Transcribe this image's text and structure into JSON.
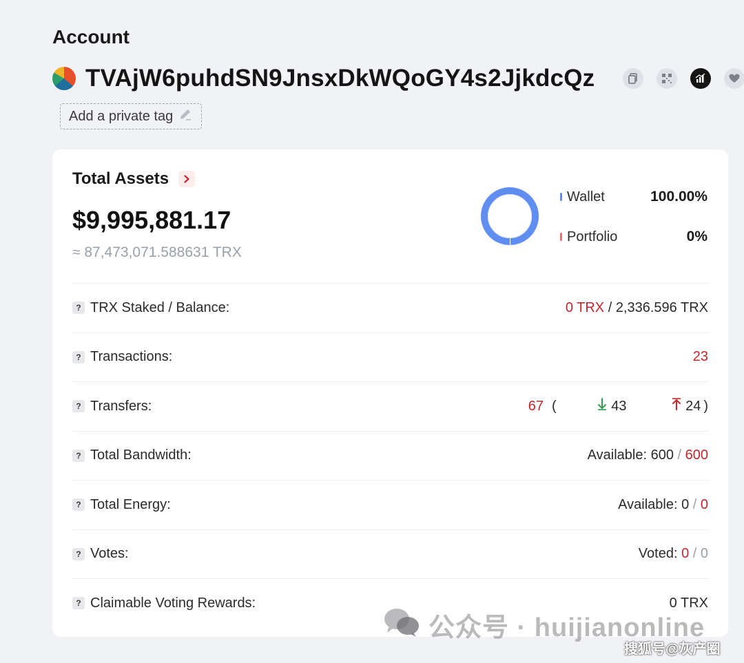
{
  "header": {
    "title": "Account",
    "address": "TVAjW6puhdSN9JnsxDkWQoGY4s2JjkdcQz",
    "tag_button_label": "Add a private tag",
    "icons": [
      "copy-icon",
      "qr-code-icon",
      "analytics-icon",
      "heart-icon",
      "more-icon"
    ]
  },
  "assets": {
    "title": "Total Assets",
    "usd": "$9,995,881.17",
    "trx": "≈ 87,473,071.588631 TRX",
    "legend": [
      {
        "name": "Wallet",
        "value": "100.00%",
        "color": "#5f8ef0",
        "fraction": 1.0
      },
      {
        "name": "Portfolio",
        "value": "0%",
        "color": "#f06f6f",
        "fraction": 0.0
      }
    ]
  },
  "rows": {
    "staked": {
      "label": "TRX Staked / Balance:",
      "staked": "0 TRX",
      "separator": " / ",
      "balance": "2,336.596 TRX"
    },
    "transactions": {
      "label": "Transactions:",
      "value": "23"
    },
    "transfers": {
      "label": "Transfers:",
      "total": "67",
      "open": "(",
      "in": "43",
      "out": "24",
      "close": ")"
    },
    "bandwidth": {
      "label": "Total Bandwidth:",
      "prefix": "Available: 600",
      "separator": " / ",
      "limit": "600"
    },
    "energy": {
      "label": "Total Energy:",
      "prefix": "Available: 0",
      "separator": " / ",
      "limit": "0"
    },
    "votes": {
      "label": "Votes:",
      "prefix": "Voted: ",
      "voted": "0",
      "separator": " / ",
      "total": "0"
    },
    "rewards": {
      "label": "Claimable Voting Rewards:",
      "value": "0 TRX"
    }
  },
  "watermark": {
    "text": "公众号 · huijianonline",
    "sohu": "搜狐号@灰产圈"
  },
  "colors": {
    "accent_red": "#c0272d",
    "wallet_blue": "#5f8ef0",
    "in_green": "#2e9d4f"
  }
}
